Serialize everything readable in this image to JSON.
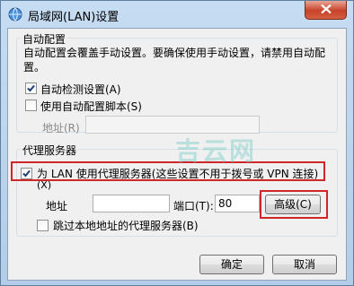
{
  "window": {
    "title": "局域网(LAN)设置",
    "icon": "network-globe-icon",
    "close": "close-icon"
  },
  "auto_config": {
    "legend": "自动配置",
    "desc_line1": "自动配置会覆盖手动设置。要确保使用手动设置，请禁用自动配",
    "desc_line2": "置。",
    "auto_detect_label": "自动检测设置(A)",
    "auto_detect_checked": true,
    "script_label": "使用自动配置脚本(S)",
    "script_checked": false,
    "address_label": "地址(R)",
    "address_value": ""
  },
  "proxy": {
    "legend": "代理服务器",
    "use_proxy_label": "为 LAN 使用代理服务器(这些设置不用于拨号或 VPN 连接)",
    "use_proxy_label2": "(X)",
    "use_proxy_checked": true,
    "address_label": "地址",
    "address_value": "",
    "port_label": "端口(T):",
    "port_value": "80",
    "advanced_button": "高级(C)",
    "bypass_label": "跳过本地地址的代理服务器(B)",
    "bypass_checked": false
  },
  "buttons": {
    "ok": "确定",
    "cancel": "取消"
  },
  "watermark": "吉云网",
  "colors": {
    "highlight_box": "#d0262a",
    "close_button": "#c7432a"
  }
}
